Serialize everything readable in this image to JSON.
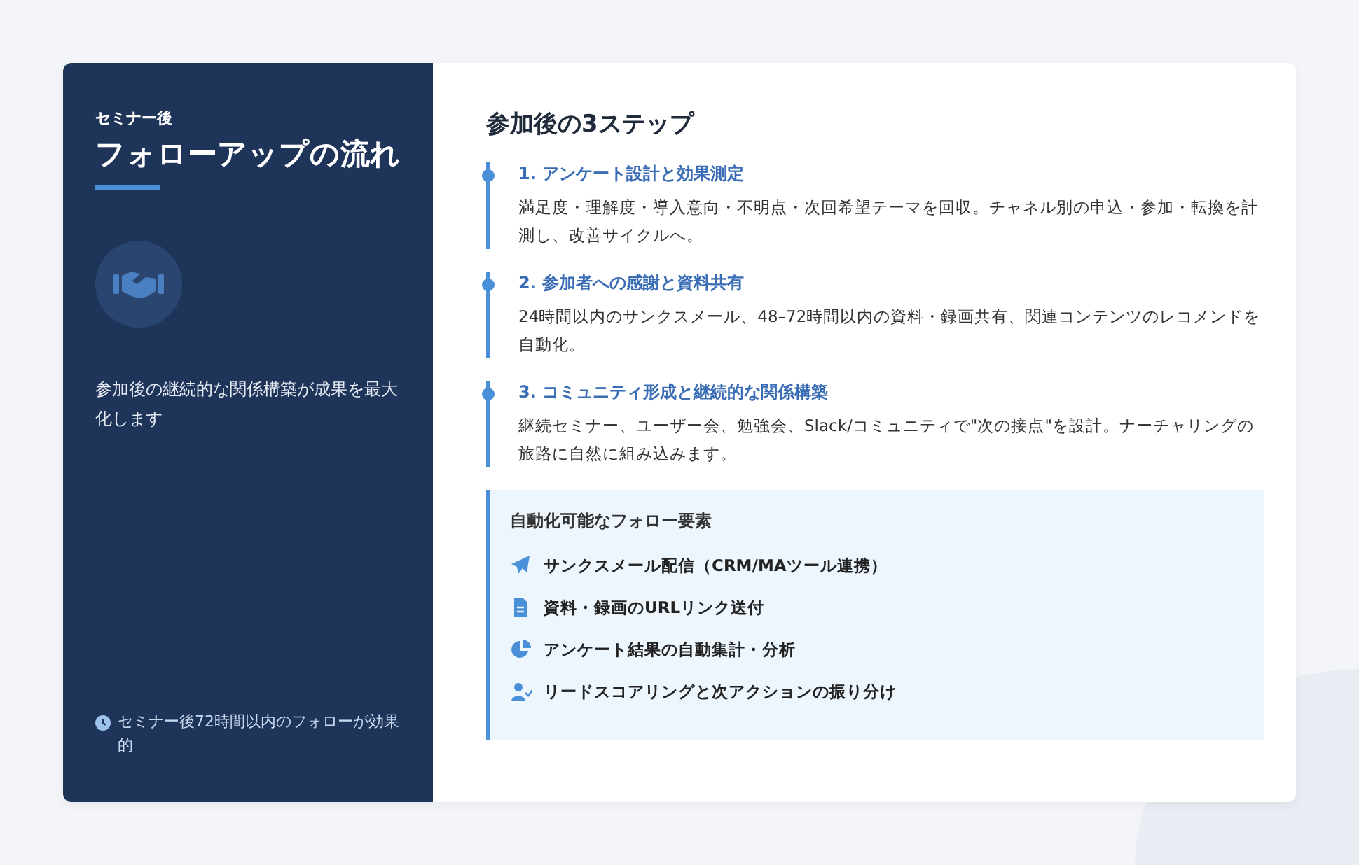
{
  "sidebar": {
    "eyebrow": "セミナー後",
    "title": "フォローアップの流れ",
    "description": "参加後の継続的な関係構築が成果を最大化します",
    "note": "セミナー後72時間以内のフォローが効果的"
  },
  "main": {
    "heading": "参加後の3ステップ",
    "steps": [
      {
        "title": "1. アンケート設計と効果測定",
        "body": "満足度・理解度・導入意向・不明点・次回希望テーマを回収。チャネル別の申込・参加・転換を計測し、改善サイクルへ。"
      },
      {
        "title": "2. 参加者への感謝と資料共有",
        "body": "24時間以内のサンクスメール、48–72時間以内の資料・録画共有、関連コンテンツのレコメンドを自動化。"
      },
      {
        "title": "3. コミュニティ形成と継続的な関係構築",
        "body": "継続セミナー、ユーザー会、勉強会、Slack/コミュニティで\"次の接点\"を設計。ナーチャリングの旅路に自然に組み込みます。"
      }
    ],
    "automation": {
      "title": "自動化可能なフォロー要素",
      "items": [
        {
          "kind": "send",
          "label": "サンクスメール配信（CRM/MAツール連携）"
        },
        {
          "kind": "file",
          "label": "資料・録画のURLリンク送付"
        },
        {
          "kind": "chart",
          "label": "アンケート結果の自動集計・分析"
        },
        {
          "kind": "user",
          "label": "リードスコアリングと次アクションの振り分け"
        }
      ]
    }
  }
}
